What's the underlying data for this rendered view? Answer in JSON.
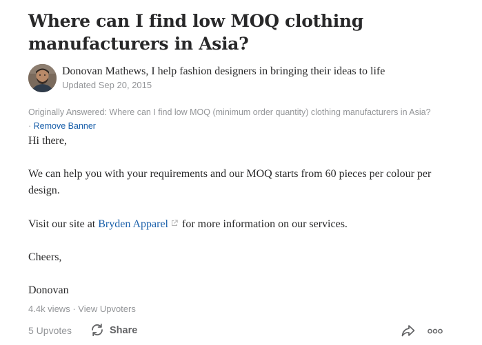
{
  "question": {
    "title": "Where can I find low MOQ clothing manufacturers in Asia?"
  },
  "author": {
    "name": "Donovan Mathews",
    "credential": ", I help fashion designers in bringing their ideas to life",
    "updated": "Updated Sep 20, 2015",
    "avatar_icon": "user-avatar-photo"
  },
  "original_question": {
    "text": "Originally Answered: Where can I find low MOQ (minimum order quantity) clothing manufacturers in Asia? · ",
    "remove_banner": "Remove Banner"
  },
  "answer": {
    "greeting": "Hi there,",
    "para1": "We can help you with your requirements and our MOQ starts from 60 pieces per colour per design.",
    "para2_before": "Visit our site at ",
    "para2_link": "Bryden Apparel",
    "para2_after": " for more information on our services.",
    "closing": "Cheers,",
    "signature": "Donovan"
  },
  "stats": {
    "views": "4.4k views",
    "separator": " · ",
    "view_upvoters": "View Upvoters"
  },
  "actions": {
    "upvotes": "5 Upvotes",
    "share_label": "Share",
    "share_icon": "refresh-share-icon",
    "forward_icon": "forward-arrow-icon",
    "more_icon": "more-options-icon"
  },
  "colors": {
    "text": "#282829",
    "muted": "#939598",
    "link": "#195faa"
  }
}
